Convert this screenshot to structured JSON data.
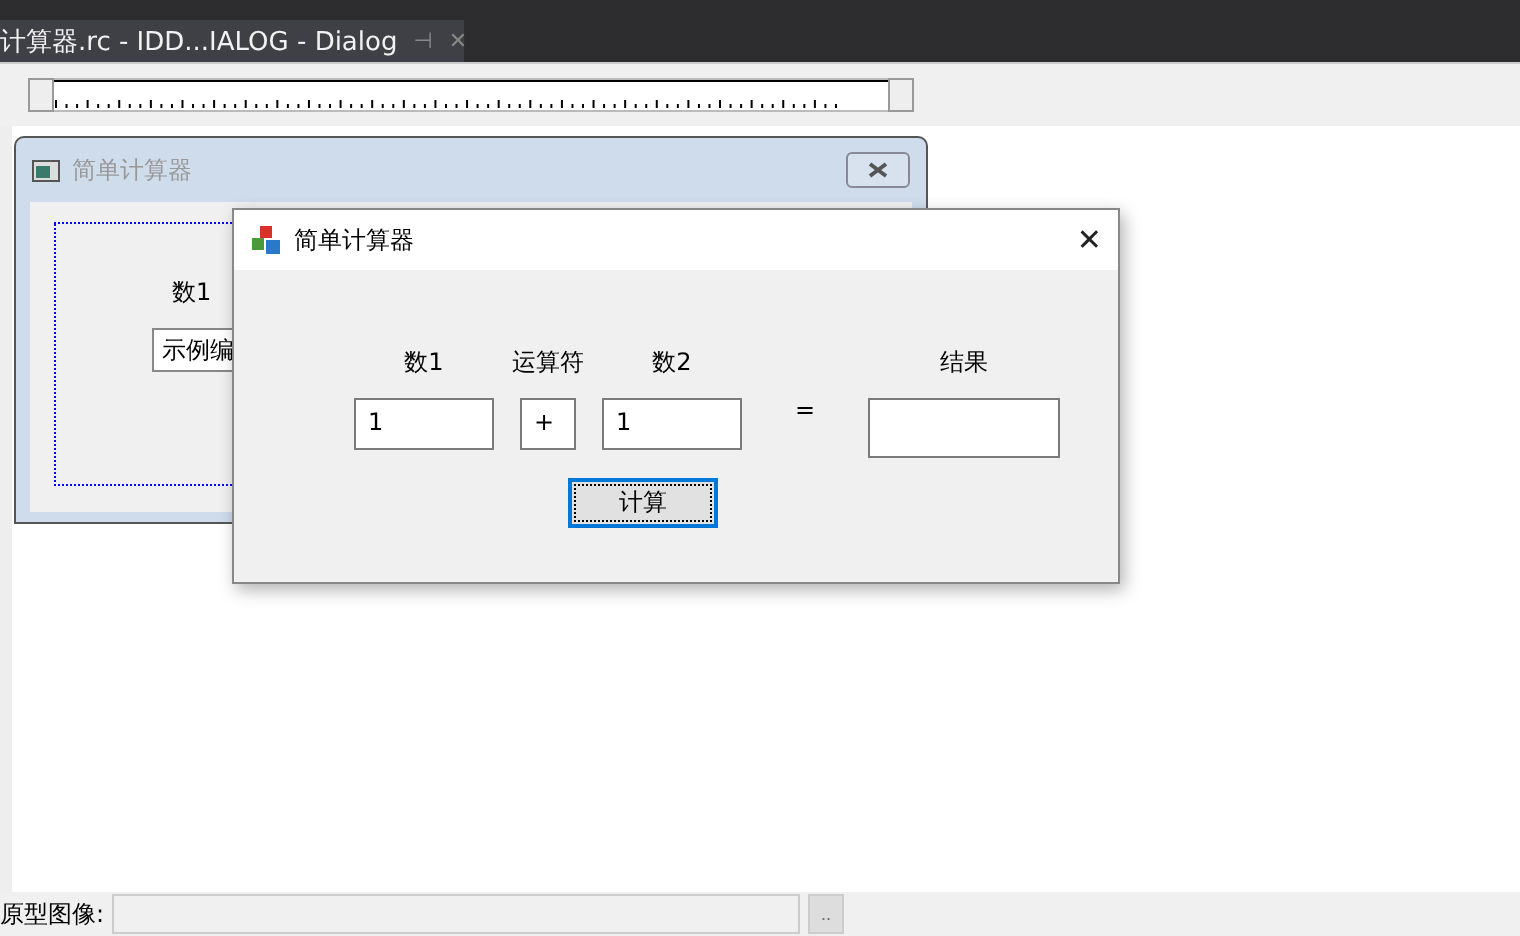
{
  "document_tab": {
    "title": "计算器.rc - IDD...IALOG - Dialog",
    "pin": "⊣",
    "close": "✕"
  },
  "design_dialog": {
    "title": "简单计算器",
    "label": "数1",
    "edit_value": "示例编"
  },
  "running_dialog": {
    "title": "简单计算器",
    "close": "✕",
    "columns": [
      {
        "kind": "edit",
        "label": "数1",
        "value": "1"
      },
      {
        "kind": "operator",
        "label": "运算符",
        "value": "+"
      },
      {
        "kind": "edit",
        "label": "数2",
        "value": "1"
      },
      {
        "kind": "equals",
        "text": "="
      },
      {
        "kind": "result",
        "label": "结果"
      }
    ],
    "button": "计算"
  },
  "status_bar": {
    "label": "原型图像:",
    "browse_button": ".."
  }
}
